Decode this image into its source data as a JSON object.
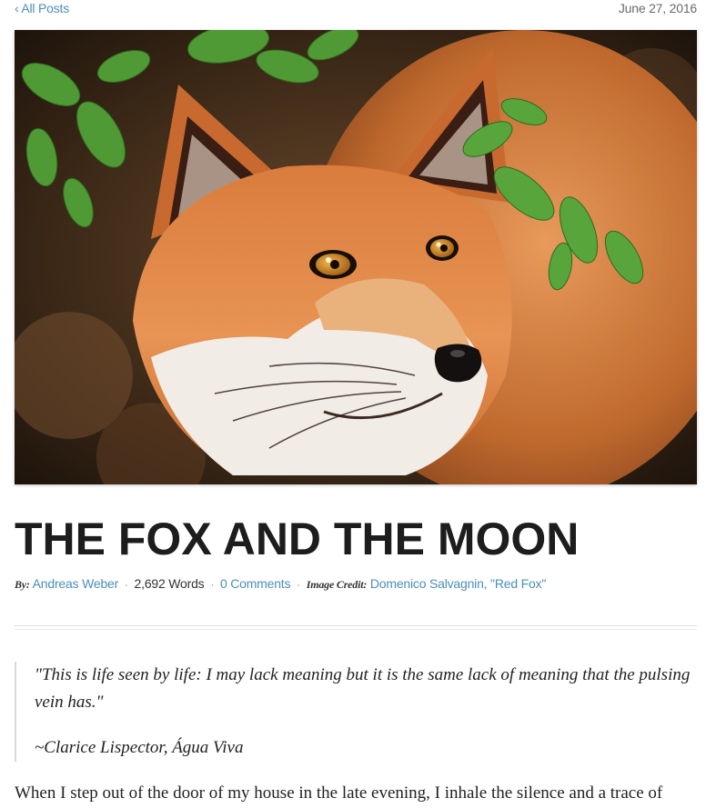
{
  "nav": {
    "back_label": "‹ All Posts",
    "date": "June 27, 2016"
  },
  "hero": {
    "icon": "fox-photo",
    "alt": "Red fox among green leaves"
  },
  "article": {
    "title": "THE FOX AND THE MOON",
    "meta": {
      "by_label": "By:",
      "author": "Andreas Weber",
      "word_count": "2,692 Words",
      "comments": "0 Comments",
      "credit_label": "Image Credit:",
      "credit": "Domenico Salvagnin, \"Red Fox\"",
      "separator": "·"
    },
    "epigraph": {
      "quote": "\"This is life seen by life: I may lack meaning but it is the same lack of meaning that the pulsing vein has.\"",
      "attribution": "~Clarice Lispector, Água Viva"
    },
    "first_line": "When I step out of the door of my house in the late evening, I inhale the silence and a trace of"
  },
  "colors": {
    "link": "#4a8fbe",
    "text": "#222222",
    "muted": "#6a6a6a"
  }
}
